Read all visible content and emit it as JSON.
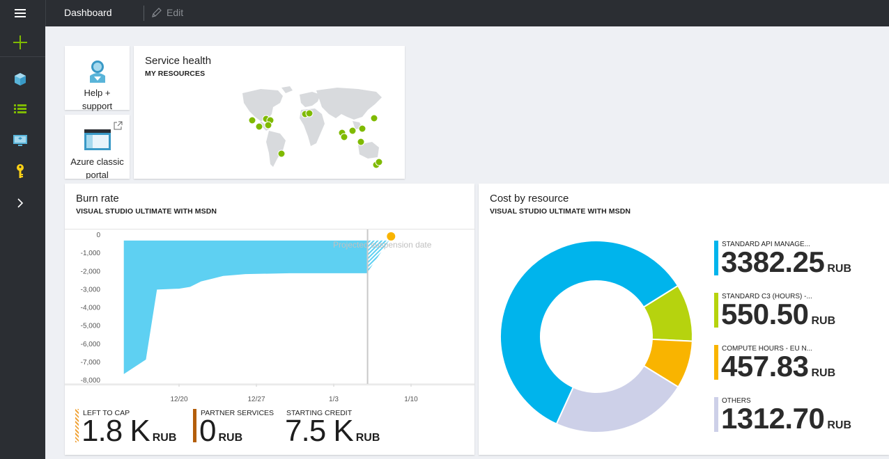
{
  "topbar": {
    "title": "Dashboard",
    "edit_label": "Edit"
  },
  "sidenav": {
    "items": [
      "menu-icon",
      "plus-icon",
      "cube-icon",
      "list-icon",
      "monitor-icon",
      "key-icon",
      "chevron-right-icon"
    ]
  },
  "tiles": {
    "help": {
      "label_line1": "Help +",
      "label_line2": "support"
    },
    "classic": {
      "label_line1": "Azure classic",
      "label_line2": "portal"
    },
    "service_health": {
      "title": "Service health",
      "subtitle": "MY RESOURCES"
    },
    "burn_rate": {
      "title": "Burn rate",
      "subtitle": "VISUAL STUDIO ULTIMATE WITH MSDN",
      "projection_label": "Projected suspension date",
      "stats": [
        {
          "label": "LEFT TO CAP",
          "value": "1.8 K",
          "unit": "RUB",
          "color": "#f0a43a"
        },
        {
          "label": "PARTNER SERVICES",
          "value": "0",
          "unit": "RUB",
          "color": "#b35e0a"
        },
        {
          "label": "STARTING CREDIT",
          "value": "7.5 K",
          "unit": "RUB",
          "color": ""
        }
      ]
    },
    "cost": {
      "title": "Cost by resource",
      "subtitle": "VISUAL STUDIO ULTIMATE WITH MSDN",
      "items": [
        {
          "label": "STANDARD API MANAGE...",
          "value": "3382.25",
          "unit": "RUB",
          "color": "#00b4ec"
        },
        {
          "label": "STANDARD C3 (HOURS) -...",
          "value": "550.50",
          "unit": "RUB",
          "color": "#b6d30e"
        },
        {
          "label": "COMPUTE HOURS - EU N...",
          "value": "457.83",
          "unit": "RUB",
          "color": "#f9b400"
        },
        {
          "label": "OTHERS",
          "value": "1312.70",
          "unit": "RUB",
          "color": "#cdd0e8"
        }
      ]
    }
  },
  "chart_data": [
    {
      "type": "area",
      "title": "Burn rate",
      "ylim": [
        -8000,
        0
      ],
      "y_ticks": [
        "0",
        "-1,000",
        "-2,000",
        "-3,000",
        "-4,000",
        "-5,000",
        "-6,000",
        "-7,000",
        "-8,000"
      ],
      "x_ticks": [
        "12/20",
        "12/27",
        "1/3",
        "1/10"
      ],
      "series": [
        {
          "x": [
            "12/15",
            "12/17",
            "12/18",
            "12/20",
            "12/21",
            "12/22",
            "12/23",
            "12/24",
            "12/25",
            "12/26",
            "12/30",
            "1/6"
          ],
          "values": [
            -7650,
            -6850,
            -3000,
            -2950,
            -2850,
            -2550,
            -2400,
            -2250,
            -2200,
            -2150,
            -2100,
            -2100
          ]
        }
      ],
      "projection": {
        "from": "1/6",
        "to": "1/8",
        "from_value": -2100,
        "to_value": -300
      }
    },
    {
      "type": "pie",
      "title": "Cost by resource",
      "labels": [
        "STANDARD API MANAGE...",
        "STANDARD C3 (HOURS) -...",
        "COMPUTE HOURS - EU N...",
        "OTHERS"
      ],
      "values": [
        3382.25,
        550.5,
        457.83,
        1312.7
      ],
      "colors": [
        "#00b4ec",
        "#b6d30e",
        "#f9b400",
        "#cdd0e8"
      ]
    }
  ]
}
